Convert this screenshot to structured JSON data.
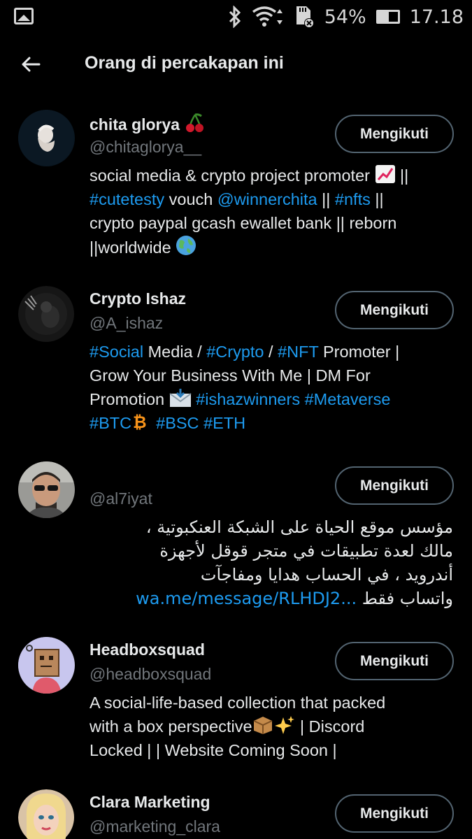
{
  "status_bar": {
    "battery_percent": "54%",
    "battery_level": 0.54,
    "time": "17.18",
    "icons": [
      "gallery-icon",
      "bluetooth-icon",
      "wifi-icon",
      "sd-card-icon",
      "battery-icon"
    ]
  },
  "header": {
    "title": "Orang di percakapan ini",
    "back_icon": "arrow-left-icon"
  },
  "users": [
    {
      "name": "chita glorya",
      "name_emoji": "cherries-icon",
      "handle": "@chitaglorya__",
      "button": "Mengikuti",
      "bio": {
        "l1a": "social media & crypto project promoter ",
        "l1b": " ||",
        "l2_tag1": "#cutetesty",
        "l2_mid": " vouch ",
        "l2_mention": "@winnerchita",
        "l2_mid2": " || ",
        "l2_tag2": "#nfts",
        "l2_end": " ||",
        "l3": "crypto paypal gcash ewallet bank || reborn",
        "l4": "||worldwide "
      }
    },
    {
      "name": "Crypto Ishaz",
      "handle": "@A_ishaz",
      "button": "Mengikuti",
      "bio": {
        "l1_tag1": "#Social",
        "l1_mid": " Media / ",
        "l1_tag2": "#Crypto",
        "l1_mid2": " / ",
        "l1_tag3": "#NFT",
        "l1_end": " Promoter |",
        "l2": "Grow Your Business With Me | DM For",
        "l3a": "Promotion ",
        "l3_tag1": "#ishazwinners",
        "l3_tag2": "#Metaverse",
        "l4_tag1": "#BTC",
        "l4_tag2": "#BSC",
        "l4_tag3": "#ETH"
      }
    },
    {
      "name": "",
      "handle": "@al7iyat",
      "button": "Mengikuti",
      "bio": {
        "l1": "مؤسس موقع الحياة على الشبكة العنكبوتية ،",
        "l2": "مالك لعدة تطبيقات في متجر قوقل لأجهزة",
        "l3": "أندرويد ، في الحساب هدايا ومفاجآت",
        "l4_text": "واتساب فقط",
        "l4_link": "wa.me/message/RLHDJ2..."
      }
    },
    {
      "name": "Headboxsquad",
      "handle": "@headboxsquad",
      "button": "Mengikuti",
      "bio": {
        "l1": "A social-life-based collection that packed",
        "l2a": "with a box perspective",
        "l2b": " | Discord",
        "l3": "Locked |   | Website Coming Soon |"
      }
    },
    {
      "name": "Clara Marketing",
      "handle": "@marketing_clara",
      "button": "Mengikuti"
    }
  ],
  "colors": {
    "background": "#000000",
    "text": "#e7e9ea",
    "secondary": "#71767b",
    "link": "#1d9bf0",
    "button_border": "#536471"
  }
}
